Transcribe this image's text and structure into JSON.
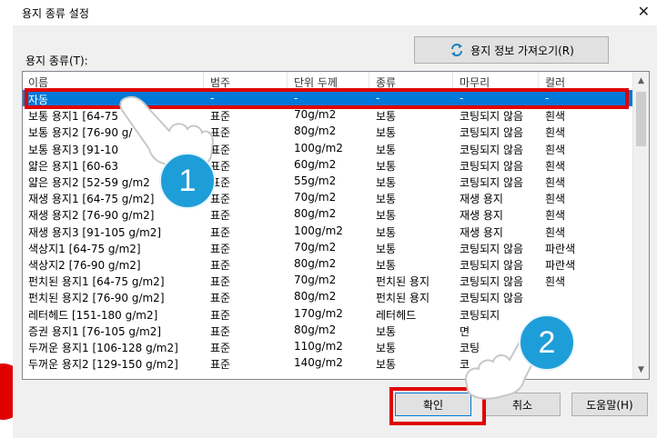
{
  "dialog": {
    "title": "용지 종류 설정",
    "close_glyph": "✕",
    "fetch_button": "용지 정보 가져오기(R)",
    "list_label": "용지 종류(T):"
  },
  "columns": [
    "이름",
    "범주",
    "단위 두께",
    "종류",
    "마무리",
    "컬러"
  ],
  "rows": [
    [
      "자동",
      "-",
      "-",
      "-",
      "-",
      "-"
    ],
    [
      "보통 용지1 [64-75",
      "표준",
      "70g/m2",
      "보통",
      "코팅되지 않음",
      "흰색"
    ],
    [
      "보통 용지2 [76-90 g/",
      "표준",
      "80g/m2",
      "보통",
      "코팅되지 않음",
      "흰색"
    ],
    [
      "보통 용지3 [91-10",
      "표준",
      "100g/m2",
      "보통",
      "코팅되지 않음",
      "흰색"
    ],
    [
      "얇은 용지1 [60-63",
      "표준",
      "60g/m2",
      "보통",
      "코팅되지 않음",
      "흰색"
    ],
    [
      "얇은 용지2 [52-59 g/m2",
      "표준",
      "55g/m2",
      "보통",
      "코팅되지 않음",
      "흰색"
    ],
    [
      "재생 용지1 [64-75 g/m2]",
      "표준",
      "70g/m2",
      "보통",
      "재생 용지",
      "흰색"
    ],
    [
      "재생 용지2 [76-90 g/m2]",
      "표준",
      "80g/m2",
      "보통",
      "재생 용지",
      "흰색"
    ],
    [
      "재생 용지3 [91-105 g/m2]",
      "표준",
      "100g/m2",
      "보통",
      "재생 용지",
      "흰색"
    ],
    [
      "색상지1 [64-75 g/m2]",
      "표준",
      "70g/m2",
      "보통",
      "코팅되지 않음",
      "파란색"
    ],
    [
      "색상지2 [76-90 g/m2]",
      "표준",
      "80g/m2",
      "보통",
      "코팅되지 않음",
      "파란색"
    ],
    [
      "펀치된 용지1 [64-75 g/m2]",
      "표준",
      "70g/m2",
      "펀치된 용지",
      "코팅되지 않음",
      "흰색"
    ],
    [
      "펀치된 용지2 [76-90 g/m2]",
      "표준",
      "80g/m2",
      "펀치된 용지",
      "코팅되지 않음",
      ""
    ],
    [
      "레터헤드 [151-180 g/m2]",
      "표준",
      "170g/m2",
      "레터헤드",
      "코팅되지",
      ""
    ],
    [
      "증권 용지1 [76-105 g/m2]",
      "표준",
      "80g/m2",
      "보통",
      "면",
      ""
    ],
    [
      "두꺼운 용지1 [106-128 g/m2]",
      "표준",
      "110g/m2",
      "보통",
      "코팅",
      ""
    ],
    [
      "두꺼운 용지2 [129-150 g/m2]",
      "표준",
      "140g/m2",
      "보통",
      "코",
      ""
    ]
  ],
  "buttons": {
    "ok": "확인",
    "cancel": "취소",
    "help": "도움말(H)"
  },
  "annotations": {
    "step1": "1",
    "step2": "2"
  },
  "colors": {
    "selection": "#0078d7",
    "highlight": "#e00000",
    "badge": "#1e9ed8"
  }
}
